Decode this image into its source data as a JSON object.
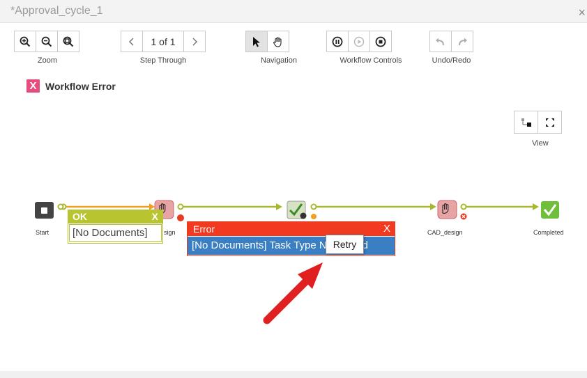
{
  "window": {
    "title": "*Approval_cycle_1",
    "close_label": "×"
  },
  "toolbar": {
    "page_indicator": "1 of 1",
    "groups": {
      "zoom": "Zoom",
      "step": "Step Through",
      "navigation": "Navigation",
      "workflow": "Workflow Controls",
      "undo": "Undo/Redo"
    }
  },
  "status": {
    "icon": "X",
    "text": "Workflow Error"
  },
  "view": {
    "label": "View"
  },
  "nodes": {
    "start": "Start",
    "cad_design": "CAD_design",
    "completed": "Completed"
  },
  "ok_popup": {
    "title": "OK",
    "close": "X",
    "body": "[No Documents]"
  },
  "error_popup": {
    "title": "Error",
    "close": "X",
    "body": "[No Documents] Task Type Not Found"
  },
  "tooltip": {
    "retry": "Retry"
  },
  "colors": {
    "link": "#a7b82e",
    "error": "#f13a20",
    "selected": "#3a7fc4",
    "arrow": "#e02020"
  }
}
